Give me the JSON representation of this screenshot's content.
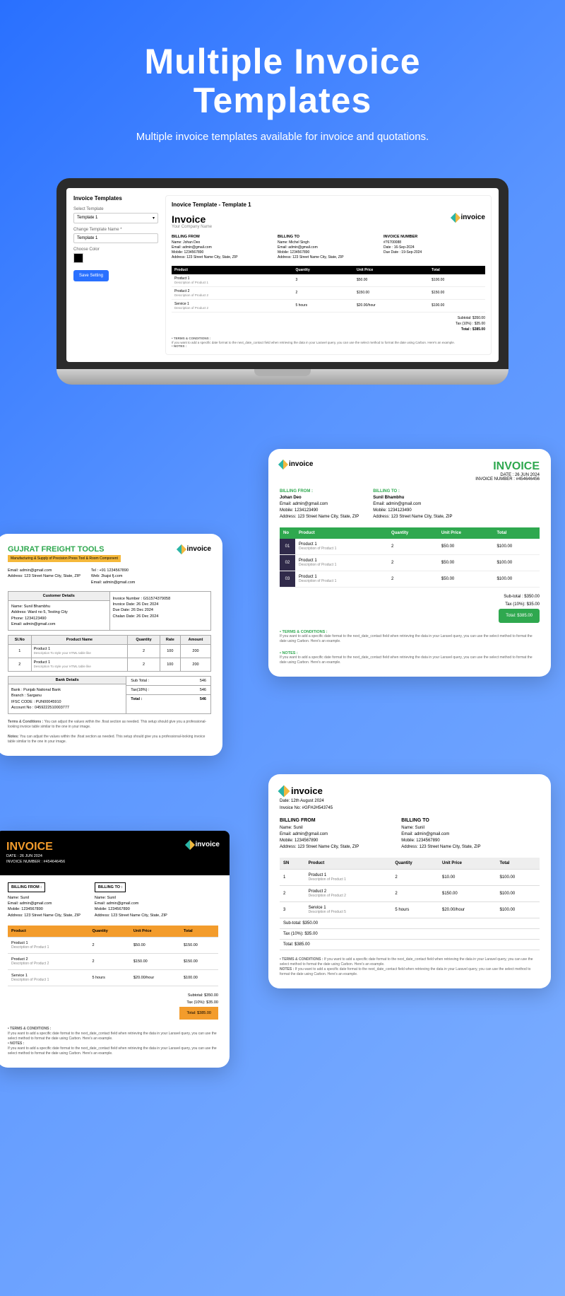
{
  "header": {
    "title1": "Multiple Invoice",
    "title2": "Templates",
    "subtitle": "Multiple invoice templates available for invoice and quotations."
  },
  "laptop": {
    "sidebar": {
      "title": "Invoice Templates",
      "select_label": "Select Template",
      "select_value": "Template 1",
      "change_label": "Change Template Name *",
      "change_value": "Template 1",
      "color_label": "Choose Color",
      "save_btn": "Save Setting"
    },
    "preview": {
      "title": "Inovice Template - Template 1",
      "invoice_word": "Invoice",
      "company_sub": "Your Company Name",
      "brand_text": "invoice",
      "billing_from": {
        "hdr": "BILLING FROM",
        "name": "Name: Johan Deo",
        "email": "Email: admin@gmail.com",
        "mobile": "Mobile: 1234567890",
        "address": "Address: 123 Street Name City, State, ZIP"
      },
      "billing_to": {
        "hdr": "BILLING TO",
        "name": "Name: Michel Singh",
        "email": "Email: admin@gmail.com",
        "mobile": "Mobile: 1234567890",
        "address": "Address: 123 Street Name City, State, ZIP"
      },
      "meta": {
        "hdr": "INVOICE NUMBER",
        "num": "#76700088",
        "date": "Date : 16-Sep-2024",
        "due": "Due Date : 19-Sep-2024"
      },
      "thead": {
        "product": "Product",
        "qty": "Quantity",
        "price": "Unit Price",
        "total": "Total"
      },
      "rows": [
        {
          "name": "Product 1",
          "desc": "Description of Product 1",
          "qty": "3",
          "price": "$50.00",
          "total": "$100.00"
        },
        {
          "name": "Product 2",
          "desc": "Description of Product 2",
          "qty": "2",
          "price": "$150.00",
          "total": "$150.00"
        },
        {
          "name": "Service 1",
          "desc": "Description of Product 2",
          "qty": "5 hours",
          "price": "$20.00/hour",
          "total": "$100.00"
        }
      ],
      "totals": {
        "sub": "Subtotal:  $350.00",
        "tax": "Tax (10%) :  $35.00",
        "total": "Total :  $385.00"
      },
      "terms_hdr": "• TERMS & CONDITIONS :",
      "terms_txt": "If you want to add a specific date format to the next_date_contact field when retrieving the data in your Laravel query, you can use the select method to format the date using Carbon. Here's an example.",
      "notes_hdr": "• NOTES :"
    }
  },
  "cardA": {
    "brand_text": "invoice",
    "inv_word": "INVOICE",
    "date": "DATE : 26 JUN 2024",
    "num": "INVOICE NUMBER : #454646456",
    "bf_hdr": "BILLING FROM :",
    "bf_name": "Johan Deo",
    "bf_email": "Email: admin@gmail.com",
    "bf_mobile": "Mobile: 1234123490",
    "bf_addr": "Address: 123 Street Name City, State, ZIP",
    "bt_hdr": "BILLING TO :",
    "bt_name": "Sunil Bhambhu",
    "bt_email": "Email: admin@gmail.com",
    "bt_mobile": "Mobile: 1234123490",
    "bt_addr": "Address: 123 Street Name City, State, ZIP",
    "thead": {
      "no": "No",
      "product": "Product",
      "qty": "Quantity",
      "price": "Unit Price",
      "total": "Total"
    },
    "rows": [
      {
        "no": "01",
        "name": "Product 1",
        "desc": "Description of Product 1",
        "qty": "2",
        "price": "$50.00",
        "total": "$100.00"
      },
      {
        "no": "02",
        "name": "Product 1",
        "desc": "Description of Product 1",
        "qty": "2",
        "price": "$50.00",
        "total": "$100.00"
      },
      {
        "no": "03",
        "name": "Product 1",
        "desc": "Description of Product 1",
        "qty": "2",
        "price": "$50.00",
        "total": "$100.00"
      }
    ],
    "sub": "Sub-total :  $350.00",
    "tax": "Tax (10%):  $35.00",
    "total": "Total:  $385.00",
    "terms_hdr": "• TERMS & CONDITIONS :",
    "terms_txt": "If you want to add a specific date format to the next_date_contact field when retrieving the data in your Laravel query, you can use the select method to format the date using Carbon. Here's an example.",
    "notes_hdr": "• NOTES :",
    "notes_txt": "If you want to add a specific date format to the next_date_contact field when retrieving the data in your Laravel query, you can use the select method to format the date using Carbon. Here's an example."
  },
  "cardB": {
    "co_name": "GUJRAT FREIGHT TOOLS",
    "tag": "Manufacturing & Supply of Precision Press Tool & Room Component",
    "brand_text": "invoice",
    "c1_email": "Email: admin@gmail.com",
    "c1_addr": "Address: 123 Street Name City, State, ZIP",
    "c2_tel": "Tel : +91 1234567890",
    "c2_web": "Web: 2kajsi fj.com",
    "c2_email": "Email: admin@gmail.com",
    "cust_hdr": "Customer Details",
    "cust_name": "Name: Sunil Bhambhu",
    "cust_addr": "Address: Ward no 5, Testing City",
    "cust_phone": "Phone: 1234123490",
    "cust_email": "Email: admin@gmail.com",
    "inv_num": "Invoice Number : GS1574379058",
    "inv_date": "Invoice Date: 26 Dec 2024",
    "due_date": "Due Date: 26 Dec 2024",
    "chalan": "Chalan Date: 26 Dec 2024",
    "thead": {
      "slno": "SI.No",
      "name": "Product Name",
      "qty": "Quantity",
      "rate": "Rate",
      "amount": "Amount"
    },
    "rows": [
      {
        "no": "1",
        "name": "Product 1",
        "desc": "Description To style your HTML table like",
        "qty": "2",
        "rate": "100",
        "amount": "200"
      },
      {
        "no": "2",
        "name": "Product 1",
        "desc": "Description To style your HTML table like",
        "qty": "2",
        "rate": "100",
        "amount": "200"
      }
    ],
    "bank_hdr": "Bank Details",
    "bank_name": "Bank : Punjab National Bank",
    "branch": "Branch : Sarganu",
    "ifsc": "IFSC CODE : PUN00045910",
    "acc": "Account No : 0459222510003777",
    "sub": "Sub Total :",
    "sub_v": "546",
    "tax": "Tax(18%) :",
    "tax_v": "546",
    "total": "Total :",
    "total_v": "546",
    "terms_hdr": "Terms & Conditions : ",
    "terms_txt": "You can adjust the values within the .float section as needed. This setup should give you a professional-looking invoice table similar to the one in your image.",
    "notes_hdr": "Notes: ",
    "notes_txt": "You can adjust the values within the .float section as needed. This setup should give you a professional-looking invoice table similar to the one in your image."
  },
  "cardC": {
    "brand_text": "invoice",
    "date": "Date: 12th August 2024",
    "num": "Invoice No: #GFHJH543745",
    "bf_hdr": "BILLING FROM",
    "bf_name": "Name: Sunil",
    "bf_email": "Email: admin@gmail.com",
    "bf_mobile": "Mobile: 1234567890",
    "bf_addr": "Address: 123 Street Name City, State, ZIP",
    "bt_hdr": "BILLING TO",
    "bt_name": "Name: Sunil",
    "bt_email": "Email: admin@gmail.com",
    "bt_mobile": "Mobile: 1234567890",
    "bt_addr": "Address: 123 Street Name City, State, ZIP",
    "thead": {
      "sn": "SN",
      "product": "Product",
      "qty": "Quantity",
      "price": "Unit Price",
      "total": "Total"
    },
    "rows": [
      {
        "sn": "1",
        "name": "Product 1",
        "desc": "Description of Product 1",
        "qty": "2",
        "price": "$10.00",
        "total": "$100.00"
      },
      {
        "sn": "2",
        "name": "Product 2",
        "desc": "Description of Product 2",
        "qty": "2",
        "price": "$150.00",
        "total": "$100.00"
      },
      {
        "sn": "3",
        "name": "Service 1",
        "desc": "Description of Product 5",
        "qty": "5 hours",
        "price": "$20.00/hour",
        "total": "$100.00"
      }
    ],
    "sub": "Sub-total:  $350.00",
    "tax": "Tax (10%):  $35.00",
    "total": "Total:  $385.00",
    "terms_hdr": "• TERMS & CONDITIONS : ",
    "terms_txt": "If you want to add a specific date format to the next_date_contact field when retrieving the data in your Laravel query, you can use the select method to format the date using Carbon. Here's an example.",
    "notes_hdr": "NOTES : ",
    "notes_txt": "If you want to add a specific date format to the next_date_contact field when retrieving the data in your Laravel query, you can use the select method to format the date using Carbon. Here's an example."
  },
  "cardD": {
    "inv_word": "INVOICE",
    "date": "DATE : 26 JUN 2024",
    "num": "INVOICE NUMBER : #454646456",
    "brand_text": "invoice",
    "bf_hdr": "BILLING FROM :",
    "bf_name": "Name: Sunil",
    "bf_email": "Email: admin@gmail.com",
    "bf_mobile": "Mobile: 1234567890",
    "bf_addr": "Address: 123 Street Name City, State, ZIP",
    "bt_hdr": "BILLING TO :",
    "bt_name": "Name: Sunil",
    "bt_email": "Email: admin@gmail.com",
    "bt_mobile": "Mobile: 1234567890",
    "bt_addr": "Address: 123 Street Name City, State, ZIP",
    "thead": {
      "product": "Product",
      "qty": "Quantity",
      "price": "Unit Price",
      "total": "Total"
    },
    "rows": [
      {
        "name": "Product 1",
        "desc": "Description of Product 1",
        "qty": "2",
        "price": "$50.00",
        "total": "$150.00"
      },
      {
        "name": "Product 2",
        "desc": "Description of Product 2",
        "qty": "2",
        "price": "$150.00",
        "total": "$150.00"
      },
      {
        "name": "Service 1",
        "desc": "Description of Product 1",
        "qty": "5 hours",
        "price": "$20.00/hour",
        "total": "$100.00"
      }
    ],
    "sub": "Subtotal:  $350.00",
    "tax": "Tax (10%):  $35.00",
    "total": "Total:  $385.00",
    "terms_hdr": "• TERMS & CONDITIONS :",
    "terms_txt": "If you want to add a specific date format to the next_date_contact field when retrieving the data in your Laravel query, you can use the select method to format the date using Carbon. Here's an example.",
    "notes_hdr": "• NOTES :",
    "notes_txt": "If you want to add a specific date format to the next_date_contact field when retrieving the data in your Laravel query, you can use the select method to format the date using Carbon. Here's an example."
  }
}
